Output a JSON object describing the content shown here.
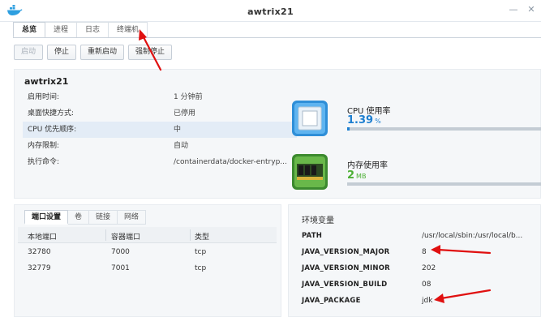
{
  "window": {
    "title": "awtrix21"
  },
  "tabs": [
    {
      "label": "总览",
      "active": true
    },
    {
      "label": "进程",
      "active": false
    },
    {
      "label": "日志",
      "active": false
    },
    {
      "label": "终端机",
      "active": false
    }
  ],
  "toolbar": {
    "start_label": "启动",
    "stop_label": "停止",
    "restart_label": "重新启动",
    "force_stop_label": "强制停止"
  },
  "container": {
    "name": "awtrix21",
    "info": [
      {
        "key": "启用时间:",
        "value": "1 分钟前"
      },
      {
        "key": "桌面快捷方式:",
        "value": "已停用"
      },
      {
        "key": "CPU 优先顺序:",
        "value": "中"
      },
      {
        "key": "内存限制:",
        "value": "自动"
      },
      {
        "key": "执行命令:",
        "value": "/containerdata/docker-entryp..."
      }
    ]
  },
  "resources": {
    "cpu": {
      "label": "CPU 使用率",
      "value": "1.39",
      "unit": "%",
      "percent": 1.39,
      "color": "#1e7fd0"
    },
    "memory": {
      "label": "内存使用率",
      "value": "2",
      "unit": "MB",
      "percent": 0,
      "color": "#4caf35"
    }
  },
  "subtabs": [
    {
      "label": "端口设置",
      "active": true
    },
    {
      "label": "卷",
      "active": false
    },
    {
      "label": "链接",
      "active": false
    },
    {
      "label": "网络",
      "active": false
    }
  ],
  "ports": {
    "headers": [
      "本地端口",
      "容器端口",
      "类型"
    ],
    "rows": [
      [
        "32780",
        "7000",
        "tcp"
      ],
      [
        "32779",
        "7001",
        "tcp"
      ]
    ]
  },
  "env": {
    "title": "环境变量",
    "rows": [
      {
        "key": "PATH",
        "value": "/usr/local/sbin:/usr/local/b..."
      },
      {
        "key": "JAVA_VERSION_MAJOR",
        "value": "8"
      },
      {
        "key": "JAVA_VERSION_MINOR",
        "value": "202"
      },
      {
        "key": "JAVA_VERSION_BUILD",
        "value": "08"
      },
      {
        "key": "JAVA_PACKAGE",
        "value": "jdk"
      }
    ]
  },
  "annotation_color": "#e01010"
}
